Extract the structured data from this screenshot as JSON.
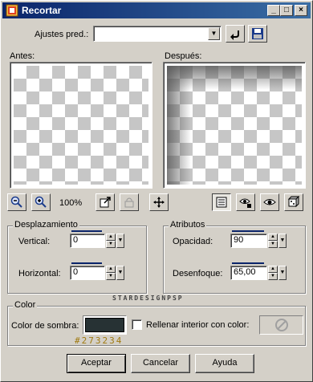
{
  "window": {
    "title": "Recortar",
    "controls": [
      "_",
      "□",
      "×"
    ]
  },
  "presets": {
    "label": "Ajustes pred.:",
    "value": ""
  },
  "preview": {
    "before_label": "Antes:",
    "after_label": "Después:",
    "zoom": "100%"
  },
  "offset": {
    "title": "Desplazamiento",
    "vertical_label": "Vertical:",
    "vertical_value": "0",
    "horizontal_label": "Horizontal:",
    "horizontal_value": "0"
  },
  "attributes": {
    "title": "Atributos",
    "opacity_label": "Opacidad:",
    "opacity_value": "90",
    "blur_label": "Desenfoque:",
    "blur_value": "65,00"
  },
  "color": {
    "title": "Color",
    "shadow_label": "Color de sombra:",
    "shadow_color": "#273234",
    "fill_label": "Rellenar interior con color:",
    "fill_checked": false,
    "hex_text": "#273234"
  },
  "watermark": "STARDESIGNPSP",
  "buttons": {
    "ok": "Aceptar",
    "cancel": "Cancelar",
    "help": "Ayuda"
  },
  "colors": {
    "titlebar_start": "#0a246a",
    "titlebar_end": "#3a6ea5",
    "face": "#d4d0c8",
    "shadow_swatch": "#273234",
    "hex_text": "#a07a10"
  }
}
